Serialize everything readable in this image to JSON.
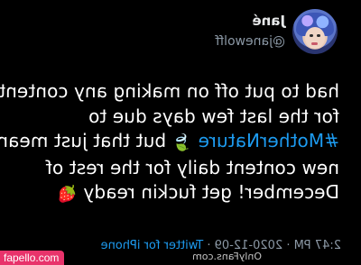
{
  "profile": {
    "display_name": "Jané",
    "handle": "@janewolff"
  },
  "tweet": {
    "lines": [
      "had to put off on making any content",
      "for the last few days due to",
      "but that just means",
      "new content daily for the rest of",
      "December! get fuckin ready"
    ],
    "hashtag": "#MotherNature",
    "emoji_leaf": "🍃",
    "emoji_strawberry": "🍓"
  },
  "meta": {
    "time": "2:47 PM",
    "separator": "·",
    "date": "2020-12-09",
    "source": "Twitter for iPhone"
  },
  "watermarks": {
    "onlyfans": "OnlyFans.com",
    "fapello": "fapello.com"
  },
  "colors": {
    "background": "#000000",
    "text": "#ffffff",
    "link": "#1d9bf0",
    "muted": "#8b98a5",
    "watermark_badge": "#e8336b"
  }
}
